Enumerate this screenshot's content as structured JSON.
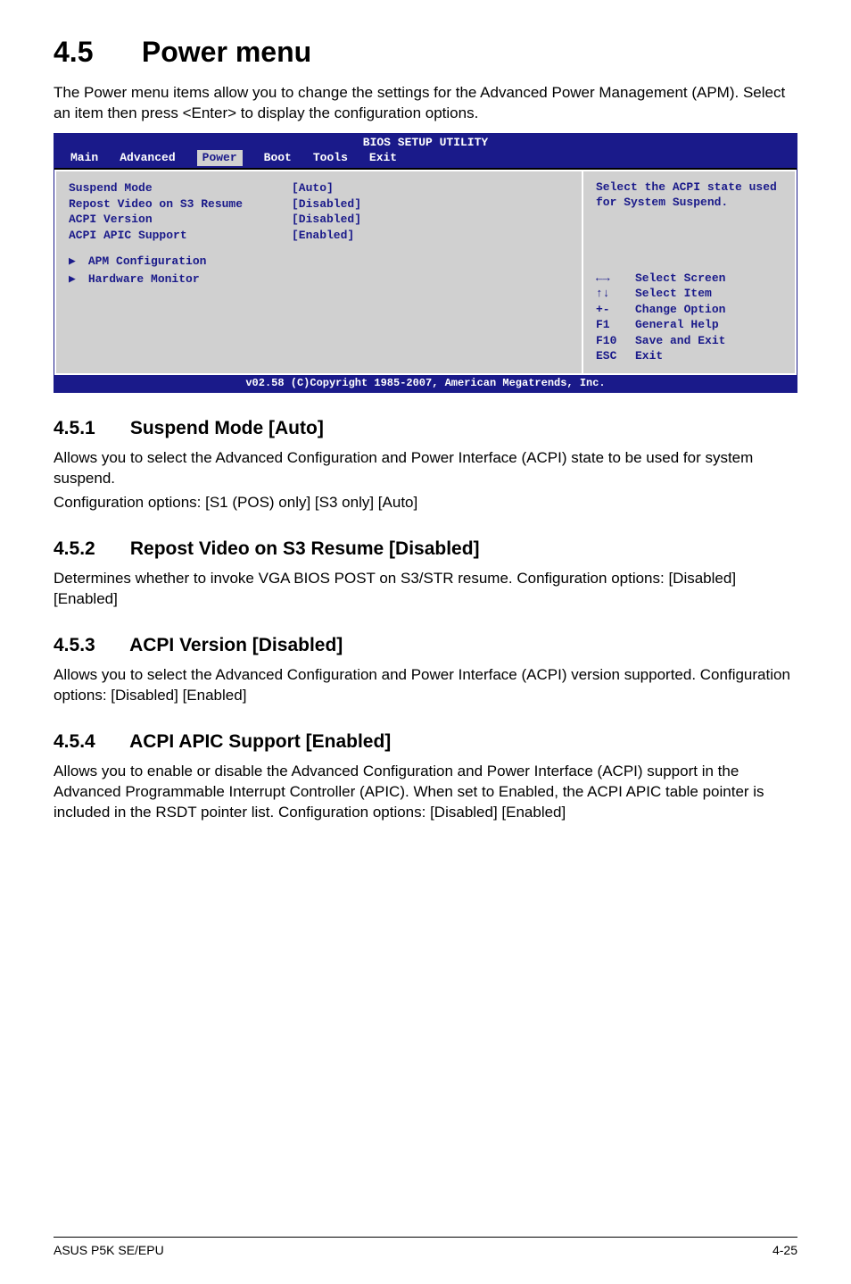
{
  "section": {
    "number": "4.5",
    "title": "Power menu"
  },
  "intro": "The Power menu items allow you to change the settings for the Advanced Power Management (APM). Select an item then press <Enter> to display the configuration options.",
  "bios": {
    "title": "BIOS SETUP UTILITY",
    "tabs": [
      "Main",
      "Advanced",
      "Power",
      "Boot",
      "Tools",
      "Exit"
    ],
    "active_tab": "Power",
    "items": [
      {
        "label": "Suspend Mode",
        "value": "[Auto]"
      },
      {
        "label": "Repost Video on S3 Resume",
        "value": "[Disabled]"
      },
      {
        "label": "ACPI Version",
        "value": "[Disabled]"
      },
      {
        "label": "ACPI APIC Support",
        "value": "[Enabled]"
      }
    ],
    "submenus": [
      "APM Configuration",
      "Hardware Monitor"
    ],
    "help_top": "Select the ACPI state used for System Suspend.",
    "help_keys": [
      {
        "key": "←→",
        "label": "Select Screen"
      },
      {
        "key": "↑↓",
        "label": "Select Item"
      },
      {
        "key": "+-",
        "label": "Change Option"
      },
      {
        "key": "F1",
        "label": "General Help"
      },
      {
        "key": "F10",
        "label": "Save and Exit"
      },
      {
        "key": "ESC",
        "label": "Exit"
      }
    ],
    "footer": "v02.58 (C)Copyright 1985-2007, American Megatrends, Inc."
  },
  "subs": [
    {
      "num": "4.5.1",
      "title": "Suspend Mode [Auto]",
      "paras": [
        "Allows you to select the Advanced Configuration and Power Interface (ACPI) state to be used for system suspend.",
        "Configuration options: [S1 (POS) only] [S3 only] [Auto]"
      ]
    },
    {
      "num": "4.5.2",
      "title": "Repost Video on S3 Resume [Disabled]",
      "paras": [
        "Determines whether to invoke VGA BIOS POST on S3/STR resume. Configuration options: [Disabled] [Enabled]"
      ]
    },
    {
      "num": "4.5.3",
      "title": "ACPI Version [Disabled]",
      "paras": [
        "Allows you to select the Advanced Configuration and Power Interface (ACPI) version supported. Configuration options: [Disabled] [Enabled]"
      ]
    },
    {
      "num": "4.5.4",
      "title": "ACPI APIC Support [Enabled]",
      "paras": [
        "Allows you to enable or disable the Advanced Configuration and Power Interface (ACPI) support in the Advanced Programmable Interrupt Controller (APIC). When set to Enabled, the ACPI APIC table pointer is included in the RSDT pointer list. Configuration options: [Disabled] [Enabled]"
      ]
    }
  ],
  "footer": {
    "left": "ASUS P5K SE/EPU",
    "right": "4-25"
  }
}
